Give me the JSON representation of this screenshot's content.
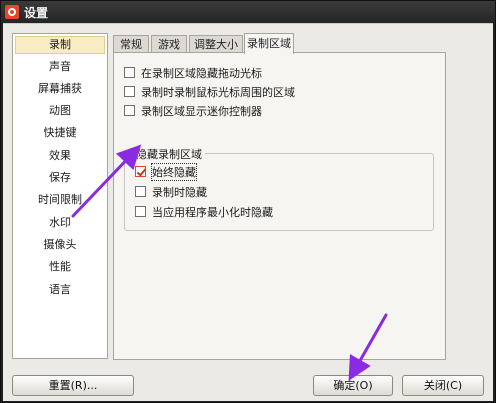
{
  "window": {
    "title": "设置"
  },
  "sidebar": {
    "items": [
      {
        "label": "录制",
        "active": true
      },
      {
        "label": "声音"
      },
      {
        "label": "屏幕捕获"
      },
      {
        "label": "动图"
      },
      {
        "label": "快捷键"
      },
      {
        "label": "效果"
      },
      {
        "label": "保存"
      },
      {
        "label": "时间限制"
      },
      {
        "label": "水印"
      },
      {
        "label": "摄像头"
      },
      {
        "label": "性能"
      },
      {
        "label": "语言"
      }
    ]
  },
  "tabs": [
    {
      "label": "常规"
    },
    {
      "label": "游戏"
    },
    {
      "label": "调整大小"
    },
    {
      "label": "录制区域",
      "active": true
    }
  ],
  "options": [
    {
      "label": "在录制区域隐藏拖动光标",
      "checked": false
    },
    {
      "label": "录制时录制鼠标光标周围的区域",
      "checked": false
    },
    {
      "label": "录制区域显示迷你控制器",
      "checked": false
    }
  ],
  "hide_group": {
    "title": "隐藏录制区域",
    "options": [
      {
        "label": "始终隐藏",
        "checked": true
      },
      {
        "label": "录制时隐藏",
        "checked": false
      },
      {
        "label": "当应用程序最小化时隐藏",
        "checked": false
      }
    ]
  },
  "buttons": {
    "reset": "重置(R)...",
    "ok": "确定(O)",
    "close": "关闭(C)"
  },
  "colors": {
    "annotation_arrow": "#8a2be2",
    "checkbox_checked": "#d84a2a"
  }
}
